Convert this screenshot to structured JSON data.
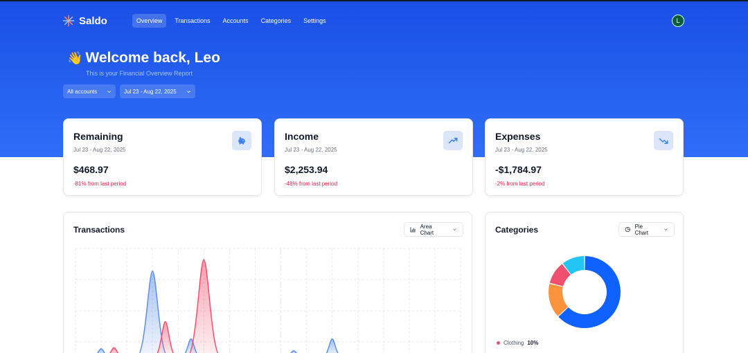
{
  "app": {
    "name": "Saldo"
  },
  "nav": {
    "items": [
      {
        "label": "Overview",
        "active": true
      },
      {
        "label": "Transactions",
        "active": false
      },
      {
        "label": "Accounts",
        "active": false
      },
      {
        "label": "Categories",
        "active": false
      },
      {
        "label": "Settings",
        "active": false
      }
    ],
    "avatar_initial": "L"
  },
  "hero": {
    "emoji": "👋",
    "title": "Welcome back, Leo",
    "subtitle": "This is your Financial Overview Report"
  },
  "filters": {
    "account": "All accounts",
    "date_range": "Jul 23 - Aug 22, 2025"
  },
  "stats": [
    {
      "title": "Remaining",
      "range": "Jul 23 - Aug 22, 2025",
      "amount": "$468.97",
      "change": "-81% from last period",
      "icon": "piggy-bank-icon"
    },
    {
      "title": "Income",
      "range": "Jul 23 - Aug 22, 2025",
      "amount": "$2,253.94",
      "change": "-48% from last period",
      "icon": "trending-up-icon"
    },
    {
      "title": "Expenses",
      "range": "Jul 23 - Aug 22, 2025",
      "amount": "-$1,784.97",
      "change": "-2% from last period",
      "icon": "trending-down-icon"
    }
  ],
  "transactions": {
    "title": "Transactions",
    "chart_type_label": "Area Chart"
  },
  "categories": {
    "title": "Categories",
    "chart_type_label": "Pie Chart",
    "legend": [
      {
        "name": "Clothing",
        "percent": "10%"
      }
    ]
  },
  "colors": {
    "hero_top": "#1a4fe6",
    "hero_bottom": "#2f6ef7",
    "income": "#3b82f6",
    "expense": "#f0506e",
    "negative_text": "#e11d48"
  },
  "chart_data": [
    {
      "type": "area",
      "title": "Transactions",
      "series": [
        {
          "name": "",
          "color": "#5b8fe8",
          "points": [
            [
              2,
              0.08
            ],
            [
              6,
              0.88
            ],
            [
              9,
              0.18
            ],
            [
              17,
              0.06
            ],
            [
              20,
              0.18
            ]
          ]
        },
        {
          "name": "",
          "color": "#f0506e",
          "points": [
            [
              3,
              0.09
            ],
            [
              7,
              0.36
            ],
            [
              10,
              1.0
            ]
          ]
        },
        {
          "name": "",
          "color": "#14b8a6",
          "points": [
            [
              8,
              0.02
            ]
          ]
        }
      ],
      "x_range": [
        0,
        30
      ],
      "grid": true
    },
    {
      "type": "pie",
      "title": "Categories",
      "donut": true,
      "slices": [
        {
          "label": "",
          "value": 60,
          "color": "#0f62fe"
        },
        {
          "label": "",
          "value": 15,
          "color": "#fb923c"
        },
        {
          "label": "Clothing",
          "value": 10,
          "color": "#f0506e"
        },
        {
          "label": "",
          "value": 10,
          "color": "#22c5f3"
        }
      ]
    }
  ]
}
